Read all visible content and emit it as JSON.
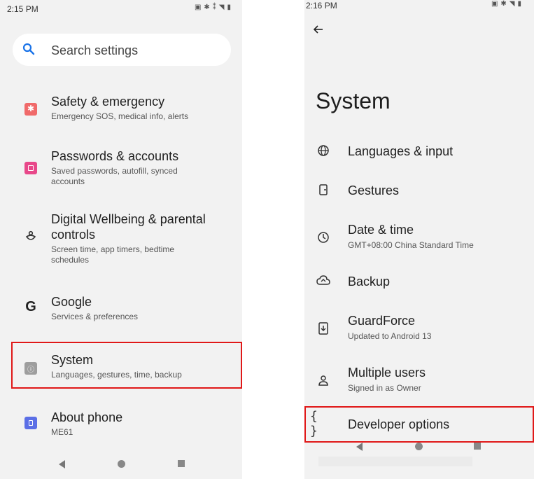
{
  "left": {
    "status_time": "2:15 PM",
    "search_label": "Search settings",
    "items": [
      {
        "title": "Safety & emergency",
        "sub": "Emergency SOS, medical info, alerts"
      },
      {
        "title": "Passwords & accounts",
        "sub": "Saved passwords, autofill, synced accounts"
      },
      {
        "title_line1": "Digital Wellbeing & parental",
        "title_line2": "controls",
        "sub": "Screen time, app timers, bedtime schedules"
      },
      {
        "title": "Google",
        "sub": "Services & preferences"
      },
      {
        "title": "System",
        "sub": "Languages, gestures, time, backup"
      },
      {
        "title": "About phone",
        "sub": "ME61"
      }
    ]
  },
  "right": {
    "status_time": "2:16 PM",
    "page_title": "System",
    "items": [
      {
        "title": "Languages & input",
        "sub": ""
      },
      {
        "title": "Gestures",
        "sub": ""
      },
      {
        "title": "Date & time",
        "sub": "GMT+08:00 China Standard Time"
      },
      {
        "title": "Backup",
        "sub": ""
      },
      {
        "title": "GuardForce",
        "sub": "Updated to Android 13"
      },
      {
        "title": "Multiple users",
        "sub": "Signed in as Owner"
      },
      {
        "title": "Developer options",
        "sub": ""
      }
    ]
  },
  "colors": {
    "highlight": "#e01818",
    "safety_icon": "#f06a6a",
    "passwords_icon": "#e8488a",
    "system_icon": "#9e9e9e",
    "about_icon": "#5b6fe6",
    "search_icon": "#1a73e8"
  },
  "icons": {
    "left": [
      "search-icon",
      "safety-icon",
      "passwords-icon",
      "digital-wellbeing-icon",
      "google-icon",
      "system-icon",
      "about-phone-icon"
    ],
    "right": [
      "back-arrow-icon",
      "globe-icon",
      "gestures-icon",
      "clock-icon",
      "backup-cloud-icon",
      "guardforce-update-icon",
      "user-icon",
      "developer-braces-icon"
    ]
  }
}
